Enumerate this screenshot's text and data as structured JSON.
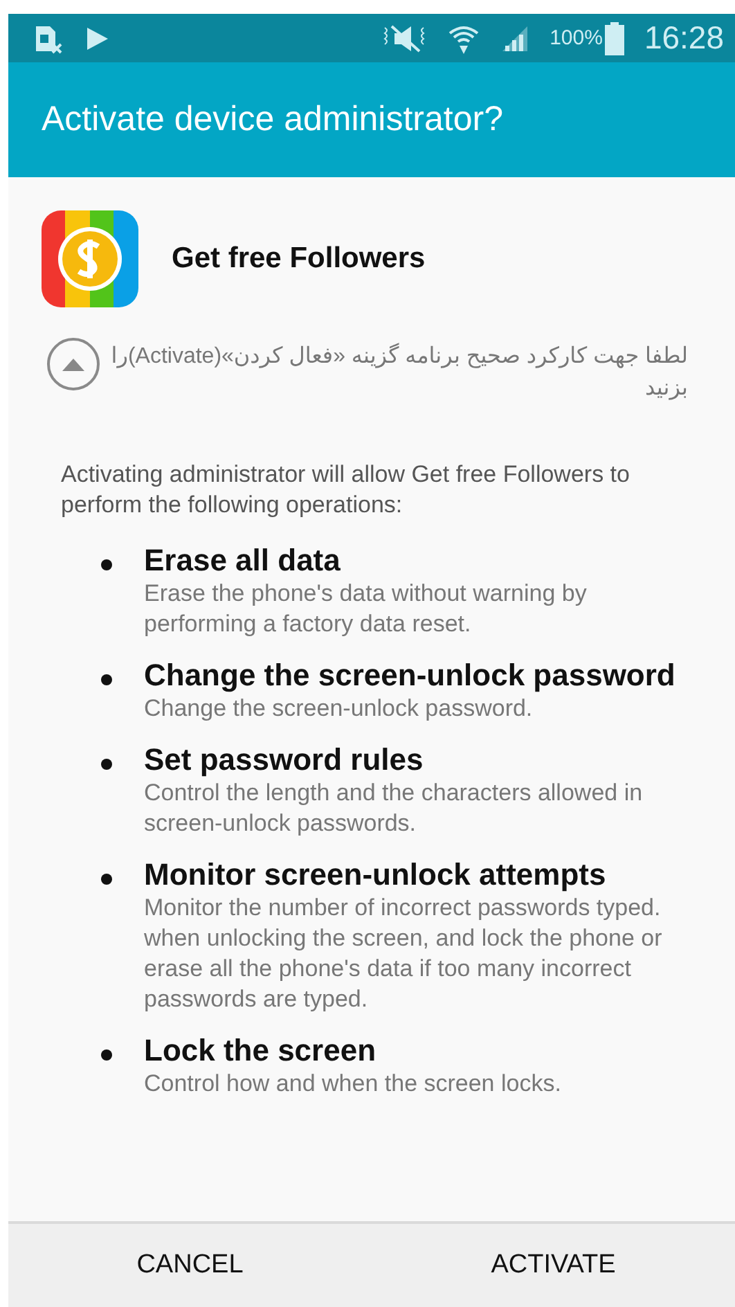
{
  "status_bar": {
    "battery": "100%",
    "time": "16:28"
  },
  "dialog": {
    "title": "Activate device administrator?"
  },
  "app": {
    "name": "Get free Followers"
  },
  "notice": "لطفا جهت کارکرد صحیح برنامه گزینه «فعال کردن»(Activate)را بزنید",
  "intro": "Activating administrator will allow Get free Followers  to perform the following operations:",
  "policies": [
    {
      "title": "Erase all data",
      "description": "Erase the phone's data without warning by performing a factory data reset."
    },
    {
      "title": "Change the screen-unlock password",
      "description": "Change the screen-unlock password."
    },
    {
      "title": "Set password rules",
      "description": "Control the length and the characters allowed in screen-unlock passwords."
    },
    {
      "title": "Monitor screen-unlock attempts",
      "description": "Monitor the number of incorrect passwords typed. when unlocking the screen, and lock the phone or erase all the phone's data if too many incorrect passwords are typed."
    },
    {
      "title": "Lock the screen",
      "description": "Control how and when the screen locks."
    }
  ],
  "buttons": [
    {
      "label": "CANCEL"
    },
    {
      "label": "ACTIVATE"
    }
  ]
}
